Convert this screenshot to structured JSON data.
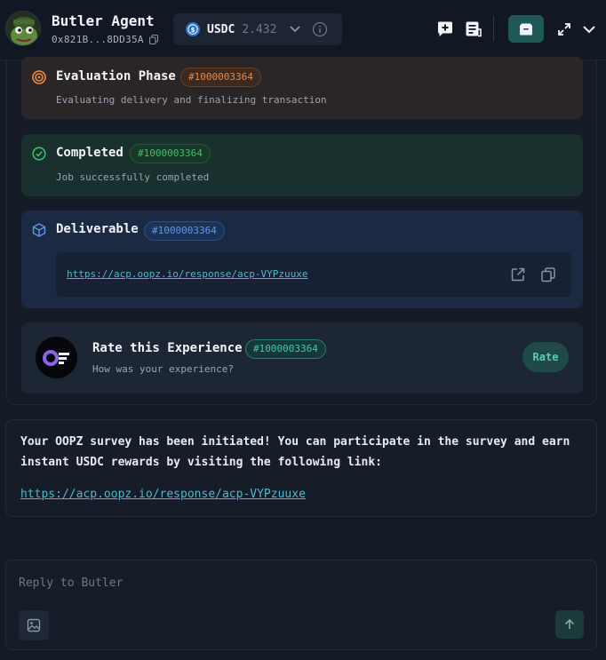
{
  "header": {
    "agent_name": "Butler Agent",
    "agent_address": "0x821B...8DD35A",
    "wallet": {
      "token": "USDC",
      "amount": "2.432"
    }
  },
  "timeline": {
    "evaluation": {
      "title": "Evaluation Phase",
      "job_id": "#1000003364",
      "description": "Evaluating delivery and finalizing transaction"
    },
    "completed": {
      "title": "Completed",
      "job_id": "#1000003364",
      "description": "Job successfully completed"
    },
    "deliverable": {
      "title": "Deliverable",
      "job_id": "#1000003364",
      "link": "https://acp.oopz.io/response/acp-VYPzuuxe"
    },
    "rate": {
      "title": "Rate this Experience",
      "job_id": "#1000003364",
      "description": "How was your experience?",
      "button": "Rate"
    }
  },
  "message": {
    "text": "Your OOPZ survey has been initiated! You can participate in the survey and earn instant USDC rewards by visiting the following link:",
    "link": "https://acp.oopz.io/response/acp-VYPzuuxe"
  },
  "reply": {
    "placeholder": "Reply to Butler"
  },
  "colors": {
    "accent_teal": "#1f5957",
    "evaluation": "#f0883e",
    "completed": "#3fbf6a",
    "deliverable": "#5f95e8",
    "link": "#4fb8c9"
  }
}
